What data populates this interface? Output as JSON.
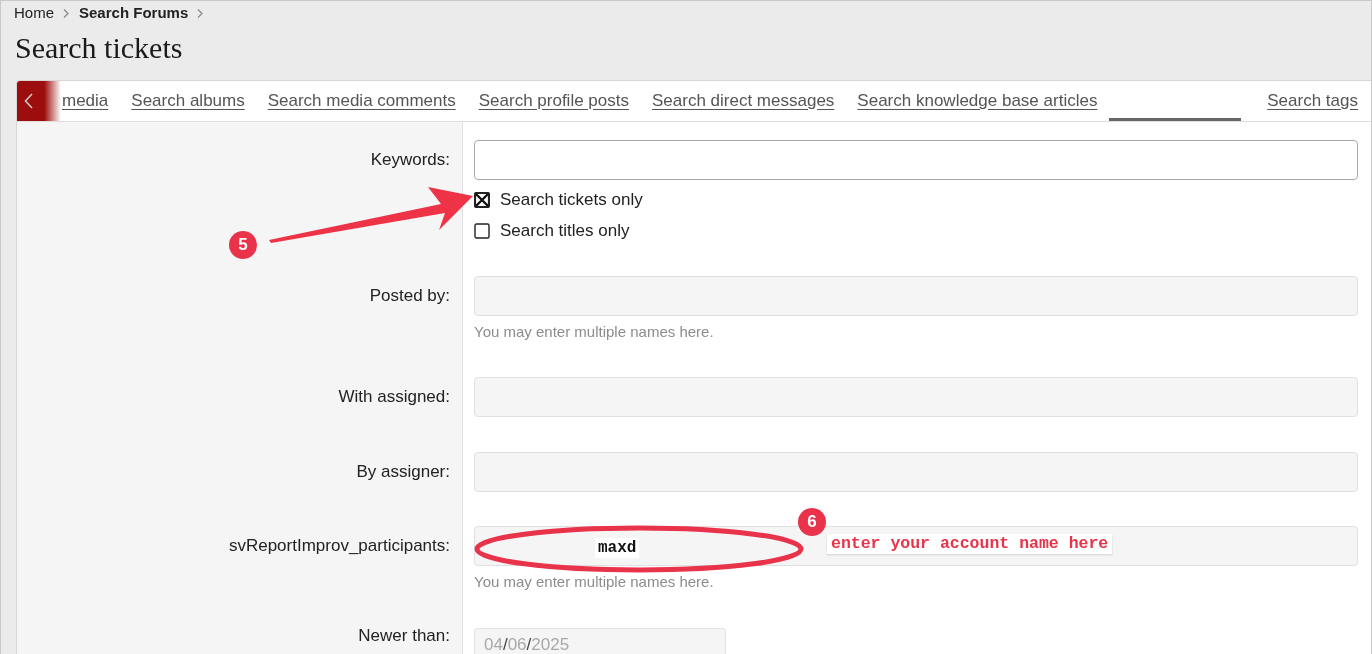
{
  "breadcrumb": [
    {
      "label": "Home",
      "current": false
    },
    {
      "label": "Search Forums",
      "current": true
    }
  ],
  "title": "Search tickets",
  "tabs": [
    {
      "label": "media",
      "selected": false
    },
    {
      "label": "Search albums",
      "selected": false
    },
    {
      "label": "Search media comments",
      "selected": false
    },
    {
      "label": "Search profile posts",
      "selected": false
    },
    {
      "label": "Search direct messages",
      "selected": false
    },
    {
      "label": "Search knowledge base articles",
      "selected": false
    },
    {
      "selected": true
    },
    {
      "label": "Search tags",
      "selected": false
    }
  ],
  "form": {
    "fields": [
      {
        "kind": "text",
        "label": "Keywords:",
        "focused": true,
        "options": [
          {
            "label": "Search tickets only",
            "checked": true
          },
          {
            "label": "Search titles only",
            "checked": false
          }
        ]
      },
      {
        "kind": "text",
        "label": "Posted by:",
        "focused": false,
        "hint": "You may enter multiple names here."
      },
      {
        "kind": "text",
        "label": "With assigned:",
        "focused": false
      },
      {
        "kind": "text",
        "label": "By assigner:",
        "focused": false
      },
      {
        "kind": "text",
        "label": "svReportImprov_participants:",
        "focused": false,
        "hint": "You may enter multiple names here."
      },
      {
        "kind": "date",
        "label": "Newer than:",
        "value": "04/06/2025"
      }
    ]
  },
  "annotations": [
    {
      "kind": "arrow",
      "badge": "5"
    },
    {
      "kind": "ellipse",
      "badge": "6",
      "text": "maxd",
      "note": "enter your account name here"
    }
  ]
}
